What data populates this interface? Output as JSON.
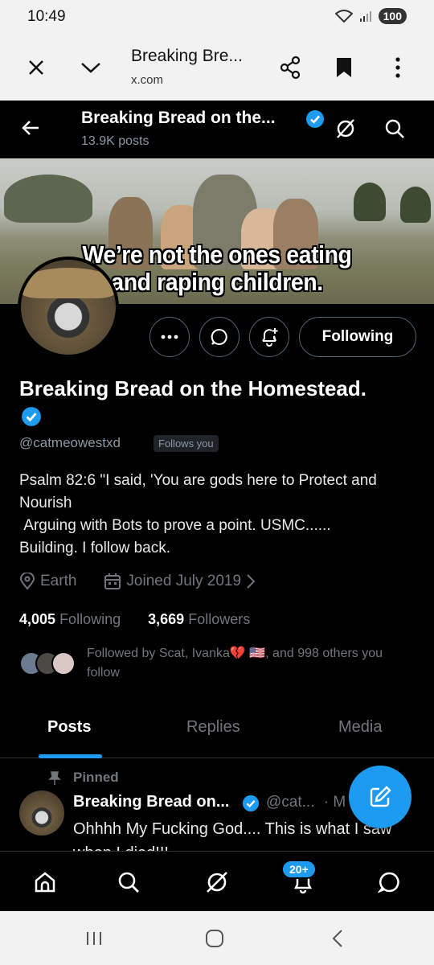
{
  "status": {
    "time": "10:49",
    "battery": "100"
  },
  "browser": {
    "title": "Breaking Bre...",
    "url": "x.com"
  },
  "profile": {
    "nav_name": "Breaking Bread on the...",
    "posts_count": "13.9K posts",
    "banner_text_line1": "We’re not the ones eating",
    "banner_text_line2": "and raping children.",
    "following_button": "Following",
    "name": "Breaking Bread on the Homestead.",
    "handle": "@catmeowestxd",
    "follows_you": "Follows you",
    "bio": "Psalm 82:6 \"I said, 'You are gods here to Protect and Nourish\n Arguing with Bots to prove a point. USMC......\nBuilding. I follow back.",
    "location": "Earth",
    "joined": "Joined July 2019",
    "following_count": "4,005",
    "following_label": "Following",
    "followers_count": "3,669",
    "followers_label": "Followers",
    "followed_by": "Followed by Scat, Ivanka💔 🇺🇸, and 998 others you follow"
  },
  "tabs": [
    "Posts",
    "Replies",
    "Media"
  ],
  "post": {
    "pinned_label": "Pinned",
    "author": "Breaking Bread on...",
    "handle": "@cat...",
    "dot_time": "· M",
    "text": "Ohhhh My Fucking God.... This is what I saw when I died!!!"
  },
  "bottom_nav": {
    "notif_badge": "20+"
  },
  "colors": {
    "accent": "#1d9bf0",
    "background": "#000000",
    "secondary_text": "#71767b"
  }
}
